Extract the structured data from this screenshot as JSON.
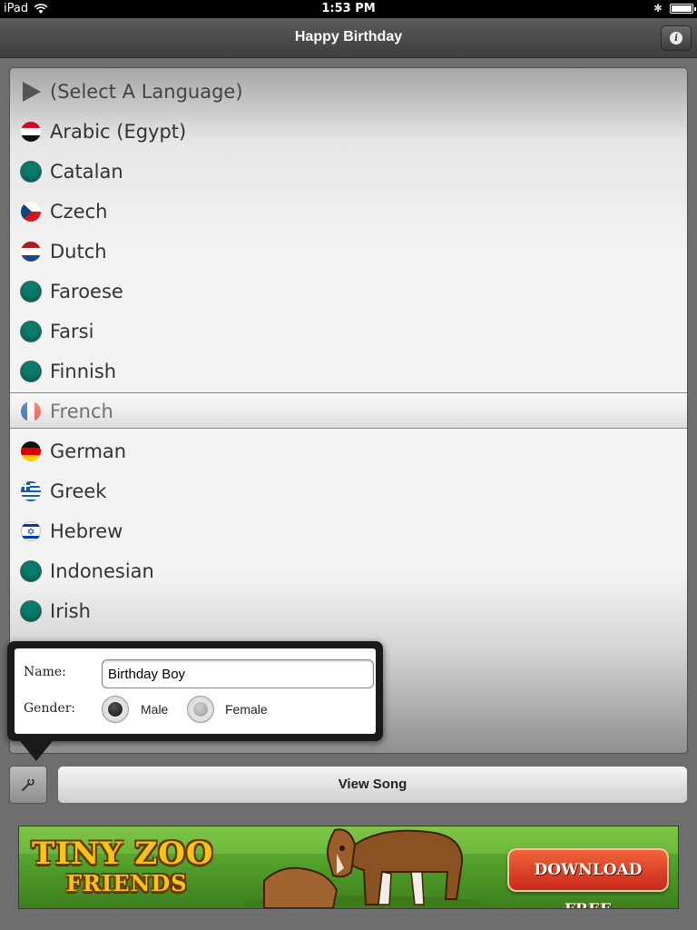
{
  "status_bar": {
    "device": "iPad",
    "time": "1:53 PM",
    "battery_level": 0.9
  },
  "nav": {
    "title": "Happy Birthday",
    "info_icon": "info-icon"
  },
  "picker": {
    "placeholder": "(Select A Language)",
    "selected": "French",
    "items": [
      {
        "label": "Arabic (Egypt)",
        "flag": "egypt-flag"
      },
      {
        "label": "Catalan",
        "flag": "generic-circle"
      },
      {
        "label": "Czech",
        "flag": "czech-flag"
      },
      {
        "label": "Dutch",
        "flag": "netherlands-flag"
      },
      {
        "label": "Faroese",
        "flag": "generic-circle"
      },
      {
        "label": "Farsi",
        "flag": "generic-circle"
      },
      {
        "label": "Finnish",
        "flag": "generic-circle"
      },
      {
        "label": "French",
        "flag": "france-flag"
      },
      {
        "label": "German",
        "flag": "germany-flag"
      },
      {
        "label": "Greek",
        "flag": "greece-flag"
      },
      {
        "label": "Hebrew",
        "flag": "israel-flag"
      },
      {
        "label": "Indonesian",
        "flag": "generic-circle"
      },
      {
        "label": "Irish",
        "flag": "generic-circle"
      }
    ]
  },
  "popover": {
    "name_label": "Name:",
    "name_value": "Birthday Boy",
    "gender_label": "Gender:",
    "gender_options": [
      {
        "label": "Male",
        "selected": true
      },
      {
        "label": "Female",
        "selected": false
      }
    ]
  },
  "toolbar": {
    "settings_icon": "wrench-icon",
    "view_song_label": "View Song"
  },
  "banner": {
    "line1": "TINY ZOO",
    "line2": "FRIENDS",
    "cta": "DOWNLOAD FREE"
  }
}
